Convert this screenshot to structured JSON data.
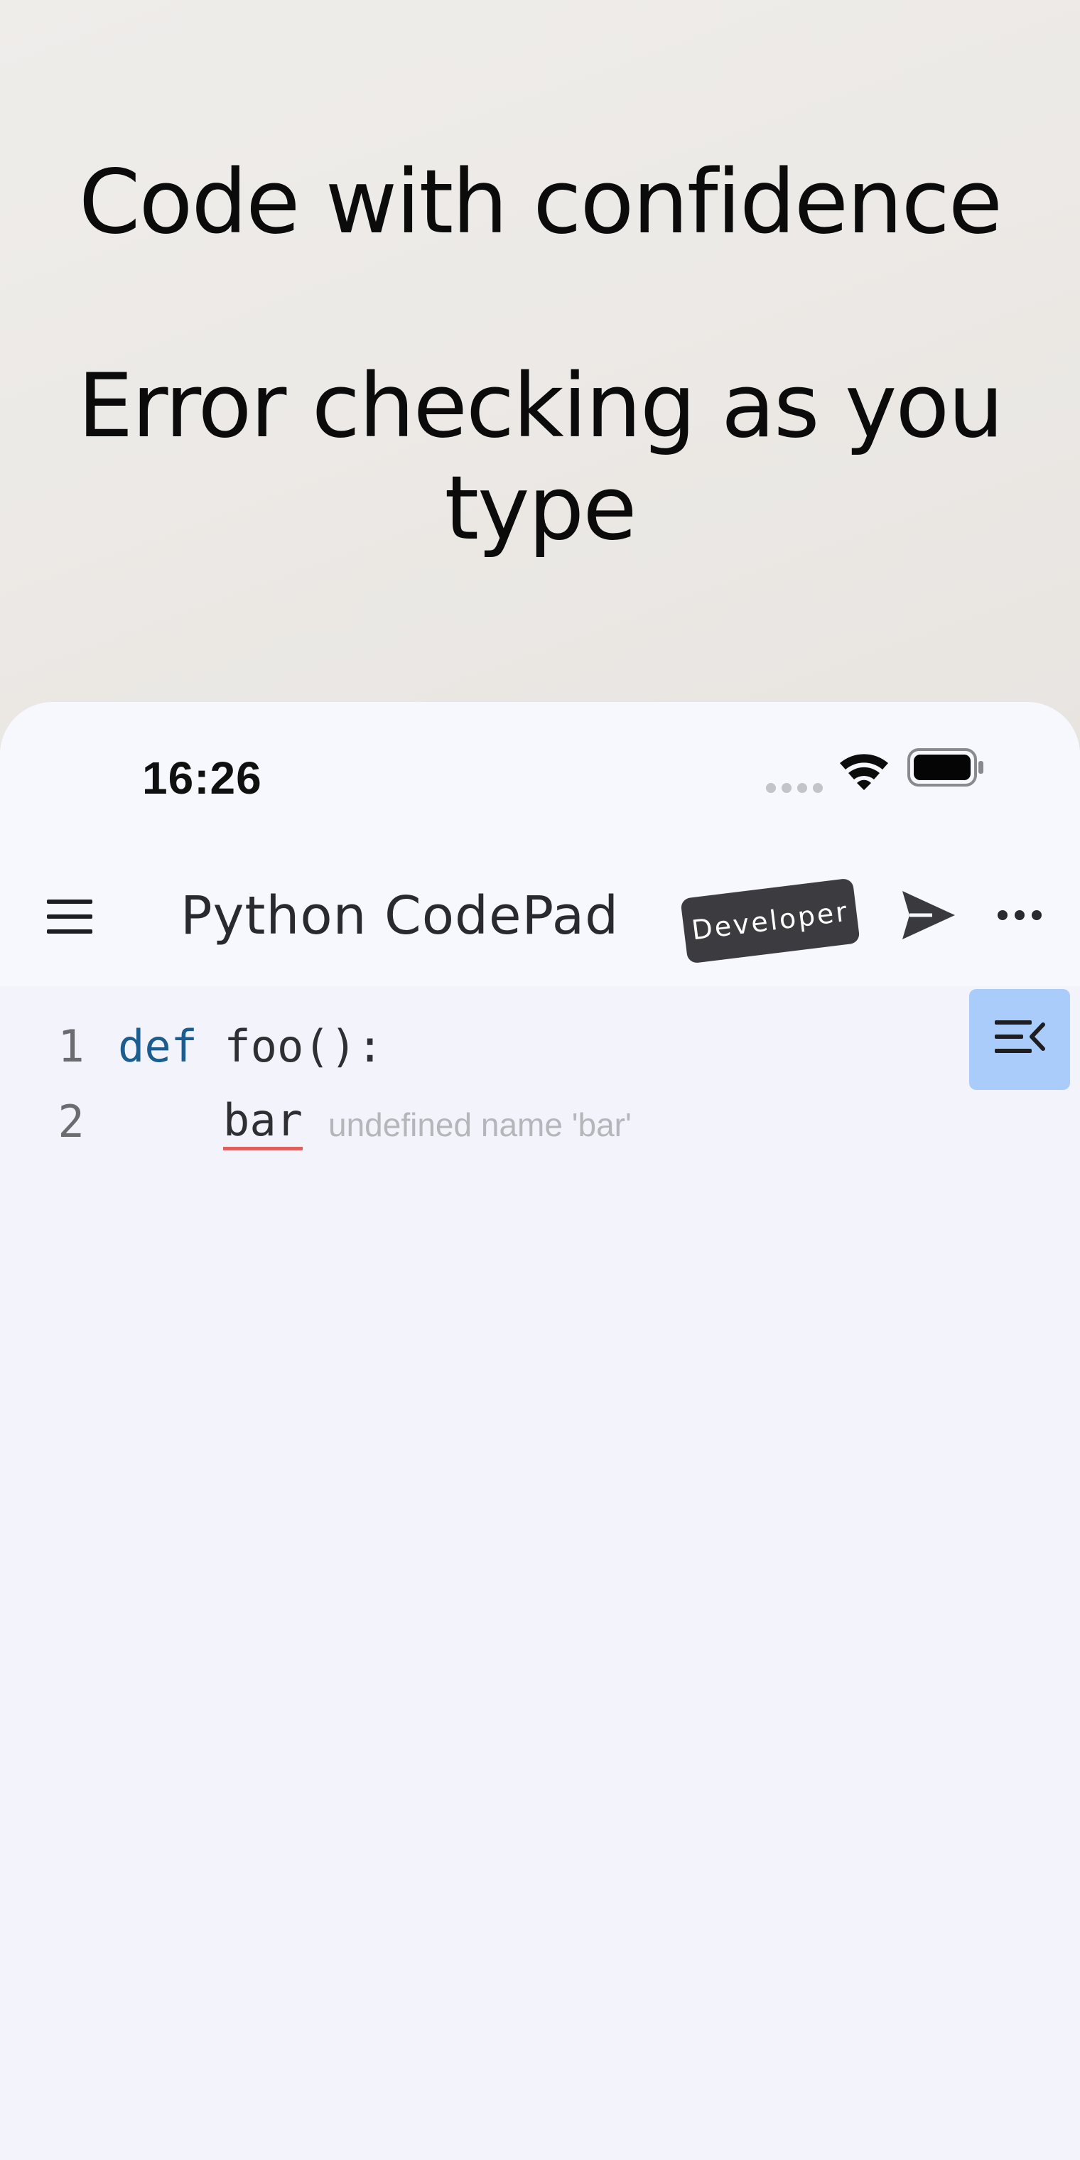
{
  "promo": {
    "headline": "Code with confidence",
    "subheadline": "Error checking as you type"
  },
  "status_bar": {
    "time": "16:26",
    "icons": [
      "cellular-signal-icon",
      "wifi-icon",
      "battery-icon"
    ]
  },
  "app_bar": {
    "menu_icon": "hamburger-menu-icon",
    "title": "Python CodePad",
    "badge": "Developer",
    "send_icon": "send-icon",
    "more_icon": "more-horizontal-icon"
  },
  "editor": {
    "lines": [
      {
        "number": "1",
        "keyword": "def",
        "text": "foo():"
      },
      {
        "number": "2",
        "indent": "    ",
        "error_token": "bar",
        "diagnostic": "undefined name 'bar'"
      }
    ],
    "outline_button_icon": "outline-collapse-icon"
  },
  "colors": {
    "keyword": "#1c5d8f",
    "error_underline": "#e06060",
    "diagnostic_text": "#b5b5ba",
    "outline_button": "#a9ccfa",
    "badge_bg": "#3c3c40"
  }
}
